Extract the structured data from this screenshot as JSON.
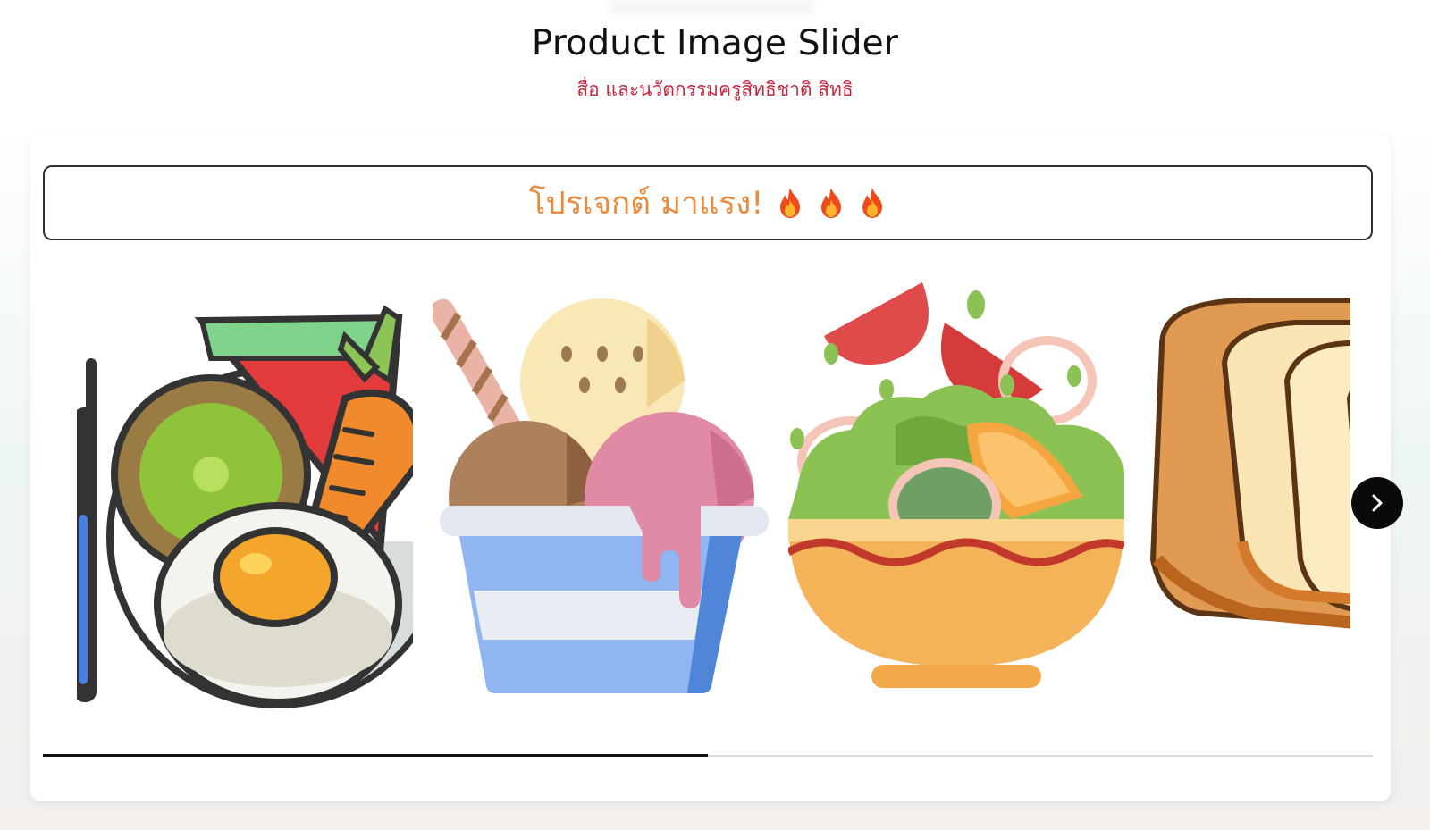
{
  "header": {
    "title": "Product Image Slider",
    "subtitle": "สื่อ และนวัตกรรมครูสิทธิชาติ สิทธิ"
  },
  "banner": {
    "text": "โปรเจกต์ มาแรง!",
    "icons": [
      "fire-icon",
      "fire-icon",
      "fire-icon"
    ]
  },
  "slider": {
    "slides": [
      {
        "name": "food-plate",
        "icon": "plate-with-egg-carrot-icon"
      },
      {
        "name": "ice-cream",
        "icon": "ice-cream-cup-icon"
      },
      {
        "name": "salad",
        "icon": "salad-bowl-icon"
      },
      {
        "name": "bread",
        "icon": "bread-loaf-icon"
      }
    ],
    "next_icon": "chevron-right-icon",
    "progress": 0.5
  },
  "colors": {
    "subtitle": "#c8283e",
    "banner_text": "#ec8a3c",
    "progress_fill": "#111111",
    "next_button": "#0a0a0a"
  }
}
